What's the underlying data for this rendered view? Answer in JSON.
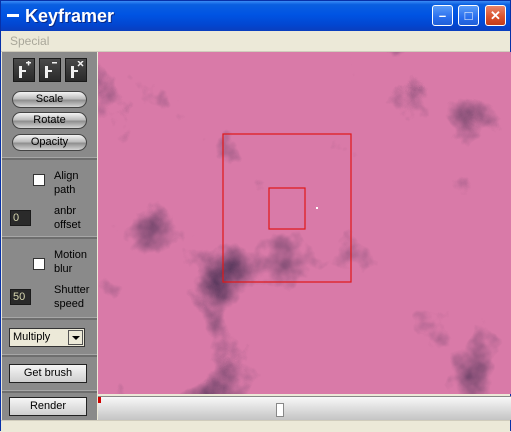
{
  "window": {
    "title": "Keyframer"
  },
  "titlebar": {
    "minimize": "–",
    "maximize": "□",
    "close": "✕"
  },
  "menu": {
    "items": [
      "Special"
    ]
  },
  "keyframe_buttons": [
    {
      "icon": "add-keyframe-icon"
    },
    {
      "icon": "set-keyframe-icon"
    },
    {
      "icon": "delete-keyframe-icon"
    }
  ],
  "mode_buttons": {
    "scale": "Scale",
    "rotate": "Rotate",
    "opacity": "Opacity"
  },
  "align": {
    "label_line1": "Align",
    "label_line2": "path"
  },
  "offset": {
    "value": "0",
    "label_line1": "anbr",
    "label_line2": "offset"
  },
  "motion_blur": {
    "label_line1": "Motion",
    "label_line2": "blur"
  },
  "shutter": {
    "value": "50",
    "label_line1": "Shutter",
    "label_line2": "speed"
  },
  "blend": {
    "selected": "Multiply"
  },
  "actions": {
    "get_brush": "Get brush",
    "render": "Render"
  },
  "colors": {
    "frame": "#e01818",
    "cloud_dark": "#1e1a3a",
    "cloud_light": "#d97aa8"
  },
  "timeline": {
    "position": 0.44
  }
}
